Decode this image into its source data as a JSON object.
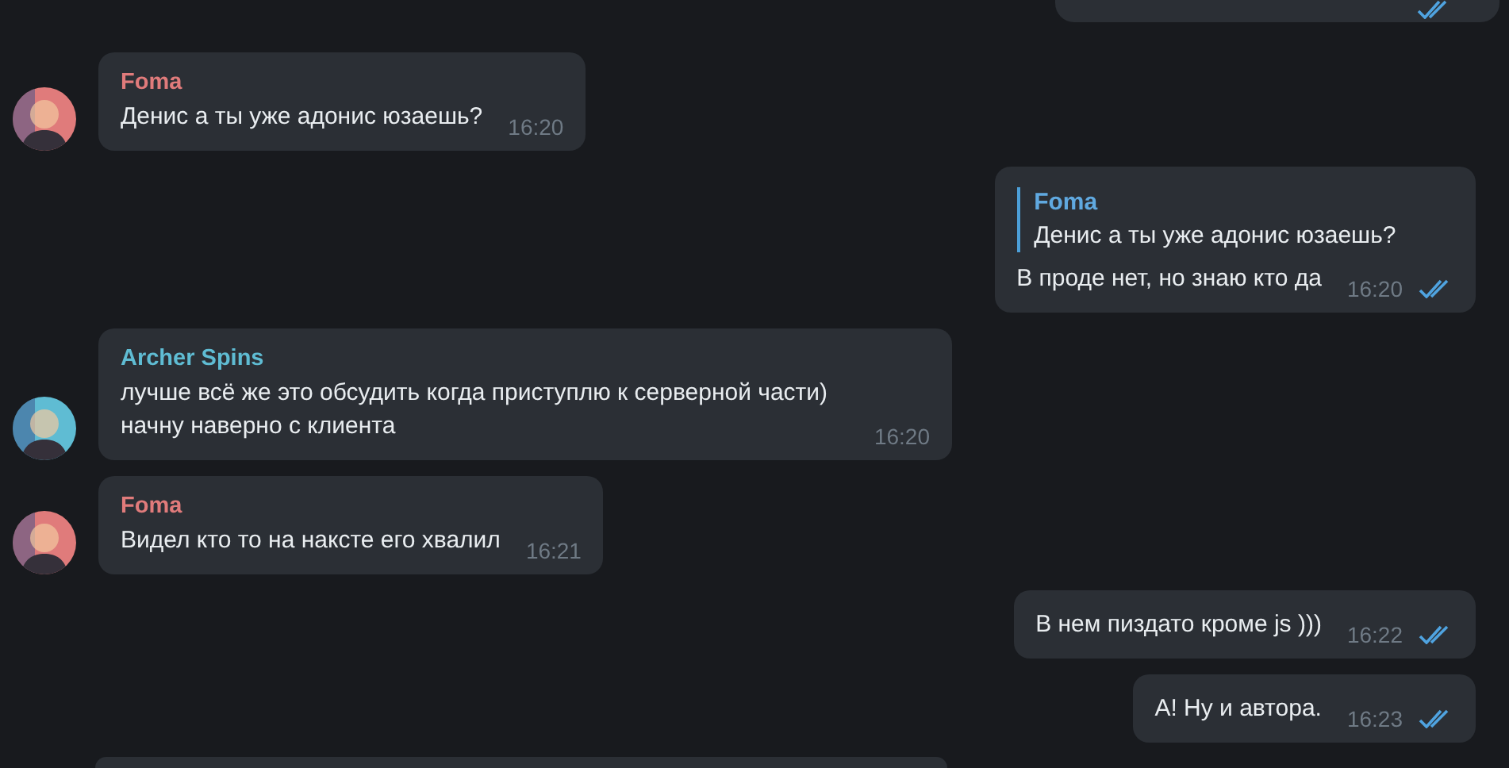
{
  "messages": [
    {
      "kind": "fragment_top",
      "read": true
    },
    {
      "kind": "incoming",
      "sender": {
        "name": "Foma",
        "color": "#e07b7b"
      },
      "text": "Денис а ты уже адонис юзаешь?",
      "time": "16:20"
    },
    {
      "kind": "outgoing",
      "reply": {
        "name": "Foma",
        "text": "Денис а ты уже адонис юзаешь?"
      },
      "text": "В проде нет, но знаю кто да",
      "time": "16:20",
      "read": true
    },
    {
      "kind": "incoming",
      "sender": {
        "name": "Archer Spins",
        "color": "#5fbcd3"
      },
      "text": "лучше всё же это обсудить когда приступлю к серверной части) начну наверно с клиента",
      "time": "16:20"
    },
    {
      "kind": "incoming",
      "sender": {
        "name": "Foma",
        "color": "#e07b7b"
      },
      "text": "Видел кто то на наксте его хвалил",
      "time": "16:21"
    },
    {
      "kind": "outgoing",
      "text": "В нем пиздато кроме js )))",
      "time": "16:22",
      "read": true
    },
    {
      "kind": "outgoing",
      "text": "А! Ну и автора.",
      "time": "16:23",
      "read": true
    },
    {
      "kind": "fragment_bottom"
    }
  ]
}
